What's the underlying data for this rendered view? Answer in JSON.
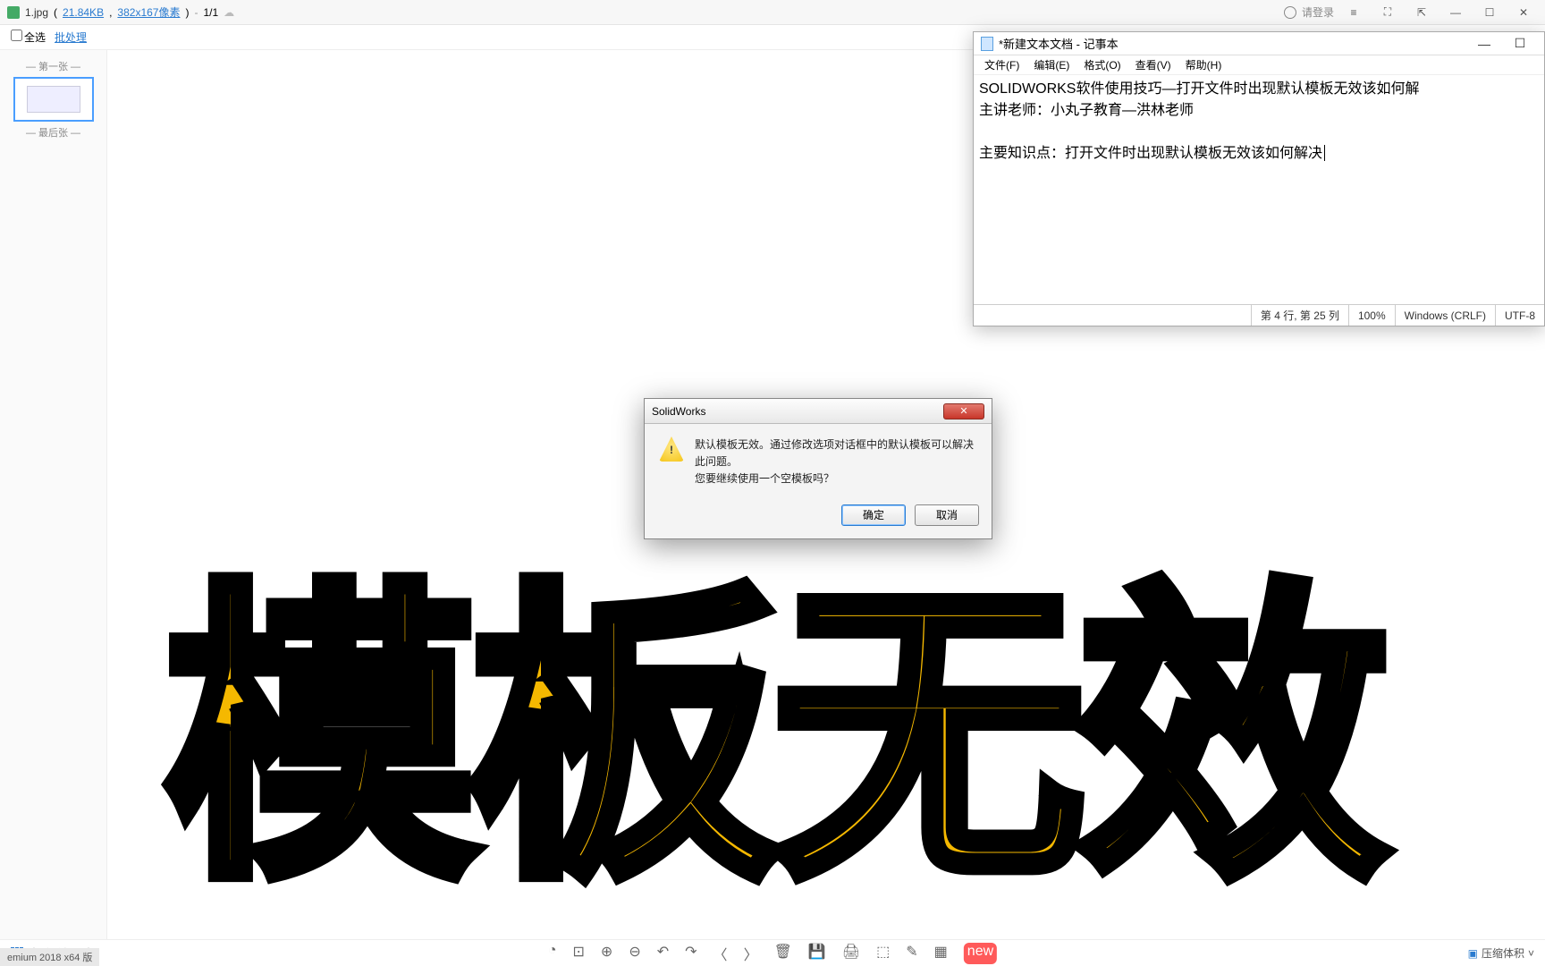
{
  "viewer": {
    "filename": "1.jpg",
    "filesize": "21.84KB",
    "dimensions": "382x167像素",
    "page_indicator": "1/1",
    "login_prompt": "请登录",
    "select_all": "全选",
    "batch": "批处理",
    "first_label": "— 第一张 —",
    "last_label": "— 最后张 —",
    "all_images": "查看所有图片",
    "compress": "压缩体积",
    "new_badge": "new"
  },
  "dialog": {
    "title": "SolidWorks",
    "line1": "默认模板无效。通过修改选项对话框中的默认模板可以解决此问题。",
    "line2": "您要继续使用一个空模板吗？",
    "ok": "确定",
    "cancel": "取消"
  },
  "notepad": {
    "title": "*新建文本文档 - 记事本",
    "menu": {
      "file": "文件(F)",
      "edit": "编辑(E)",
      "format": "格式(O)",
      "view": "查看(V)",
      "help": "帮助(H)"
    },
    "content_line1": "SOLIDWORKS软件使用技巧—打开文件时出现默认模板无效该如何解",
    "content_line2": "主讲老师：小丸子教育—洪林老师",
    "content_line3": "",
    "content_line4": "主要知识点：打开文件时出现默认模板无效该如何解决",
    "status": {
      "position": "第 4 行, 第 25 列",
      "zoom": "100%",
      "line_ending": "Windows (CRLF)",
      "encoding": "UTF-8"
    }
  },
  "overlay_text": "模板无效",
  "taskbar": "emium 2018 x64 版"
}
